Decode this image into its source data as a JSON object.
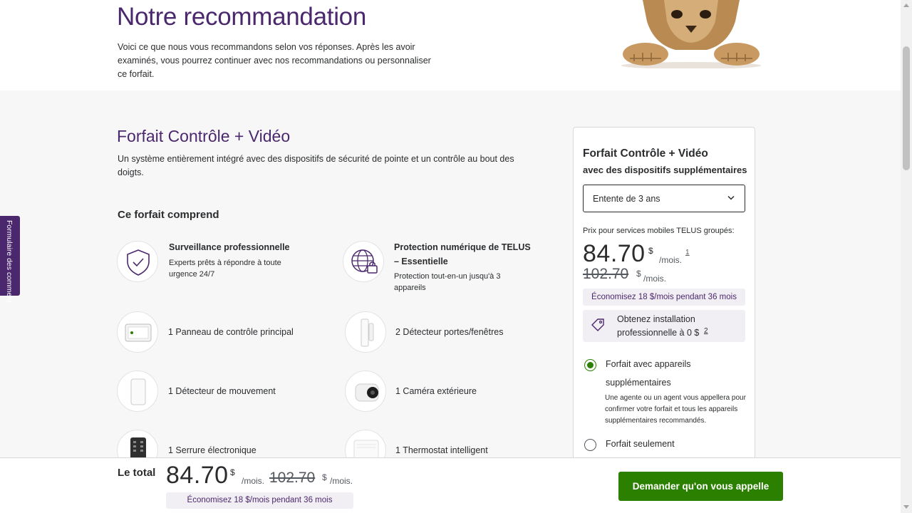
{
  "header": {
    "title": "Notre recommandation",
    "intro": "Voici ce que nous vous recommandons selon vos réponses. Après les avoir examinés, vous pourrez continuer avec nos recommandations ou personnaliser ce forfait."
  },
  "feedback_tab": {
    "label": "Formulaire des comment"
  },
  "plan": {
    "title": "Forfait Contrôle + Vidéo",
    "description": "Un système entièrement intégré avec des dispositifs de sécurité de pointe et un contrôle au bout des doigts.",
    "includes_heading": "Ce forfait comprend",
    "features": [
      {
        "title": "Surveillance professionnelle",
        "subtitle": "Experts prêts à répondre à toute urgence 24/7",
        "icon": "shield-check-icon"
      },
      {
        "title": "Protection numérique de TELUS – Essentielle",
        "subtitle": "Protection tout-en-un jusqu'à 3 appareils",
        "icon": "globe-lock-icon"
      }
    ],
    "devices": [
      {
        "label": "1 Panneau de contrôle principal",
        "icon": "control-panel-icon"
      },
      {
        "label": "2 Détecteur portes/fenêtres",
        "icon": "door-sensor-icon"
      },
      {
        "label": "1 Détecteur de mouvement",
        "icon": "motion-sensor-icon"
      },
      {
        "label": "1 Caméra extérieure",
        "icon": "camera-icon"
      },
      {
        "label": "1 Serrure électronique",
        "icon": "smart-lock-icon"
      },
      {
        "label": "1 Thermostat intelligent",
        "icon": "thermostat-icon"
      }
    ]
  },
  "card": {
    "title": "Forfait Contrôle + Vidéo",
    "subtitle": "avec des dispositifs supplémentaires",
    "term_select": "Entente de 3 ans",
    "bundle_label": "Prix pour services mobiles TELUS groupés:",
    "price": "84.70",
    "currency": "$",
    "per_month": "/mois.",
    "footnote_1": "1",
    "old_price": "102.70",
    "savings": "Économisez 18 $/mois pendant 36 mois",
    "install_text": "Obtenez installation professionnelle à 0 $",
    "footnote_2": "2",
    "options": [
      {
        "label": "Forfait avec appareils supplémentaires",
        "description": "Une agente ou un agent vous appellera pour confirmer votre forfait et tous les appareils supplémentaires recommandés.",
        "selected": true
      },
      {
        "label": "Forfait seulement",
        "selected": false
      }
    ]
  },
  "footer": {
    "total_label": "Le total",
    "price": "84.70",
    "currency": "$",
    "per_month": "/mois.",
    "old_price": "102.70",
    "savings": "Économisez 18 $/mois pendant 36 mois",
    "cta": "Demander qu'on vous appelle"
  },
  "colors": {
    "brand_purple": "#4b286d",
    "brand_green": "#2b8000",
    "highlight": "#f2eff4"
  }
}
